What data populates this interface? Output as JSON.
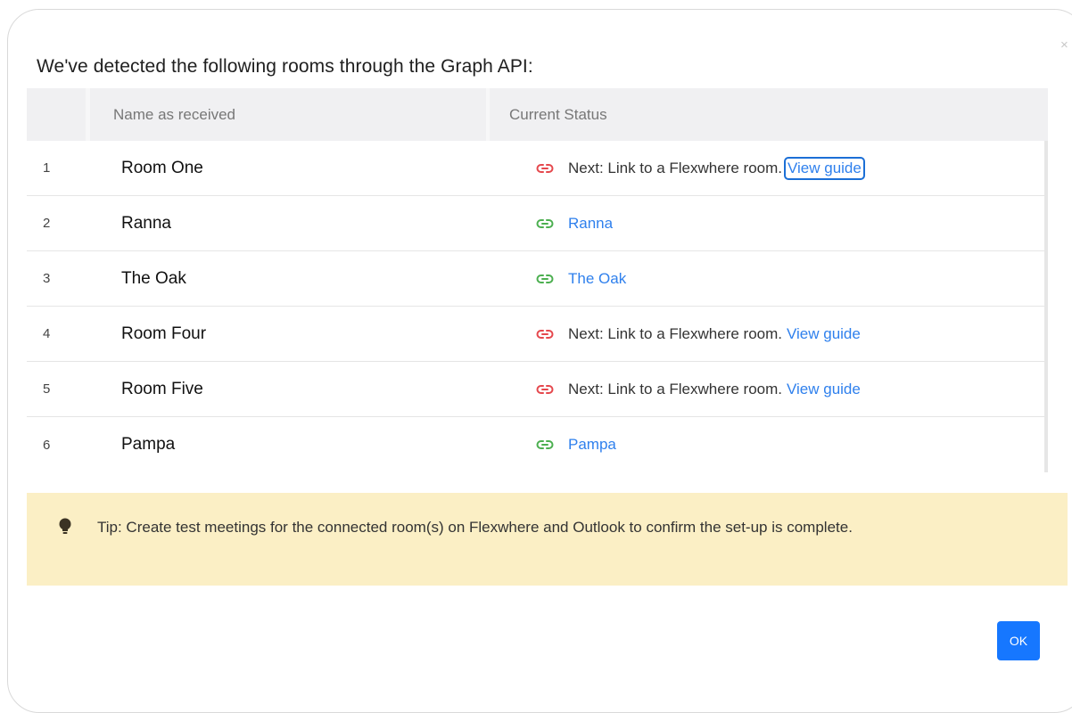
{
  "dialog": {
    "close_label": "×",
    "title": "We've detected the following rooms through the Graph API:"
  },
  "table": {
    "columns": [
      "",
      "Name as received",
      "Current Status"
    ],
    "rows": [
      {
        "num": "1",
        "name": "Room One",
        "linked": false,
        "status_text": "Next: Link to a Flexwhere room.",
        "link_text": "View guide",
        "focused": true
      },
      {
        "num": "2",
        "name": "Ranna",
        "linked": true,
        "status_text": "",
        "link_text": "Ranna"
      },
      {
        "num": "3",
        "name": "The Oak",
        "linked": true,
        "status_text": "",
        "link_text": "The Oak"
      },
      {
        "num": "4",
        "name": "Room Four",
        "linked": false,
        "status_text": "Next: Link to a Flexwhere room.",
        "link_text": "View guide"
      },
      {
        "num": "5",
        "name": "Room Five",
        "linked": false,
        "status_text": "Next: Link to a Flexwhere room.",
        "link_text": "View guide"
      },
      {
        "num": "6",
        "name": "Pampa",
        "linked": true,
        "status_text": "",
        "link_text": "Pampa"
      }
    ]
  },
  "tip": {
    "icon": "lightbulb-icon",
    "text": "Tip: Create test meetings for the connected room(s) on Flexwhere and Outlook to confirm the set-up is complete."
  },
  "footer": {
    "ok_label": "OK"
  },
  "colors": {
    "linked": "#4caf50",
    "unlinked": "#e5484d",
    "link": "#2f80ed",
    "primary_button": "#1677ff",
    "tip_background": "#fbefc5"
  }
}
